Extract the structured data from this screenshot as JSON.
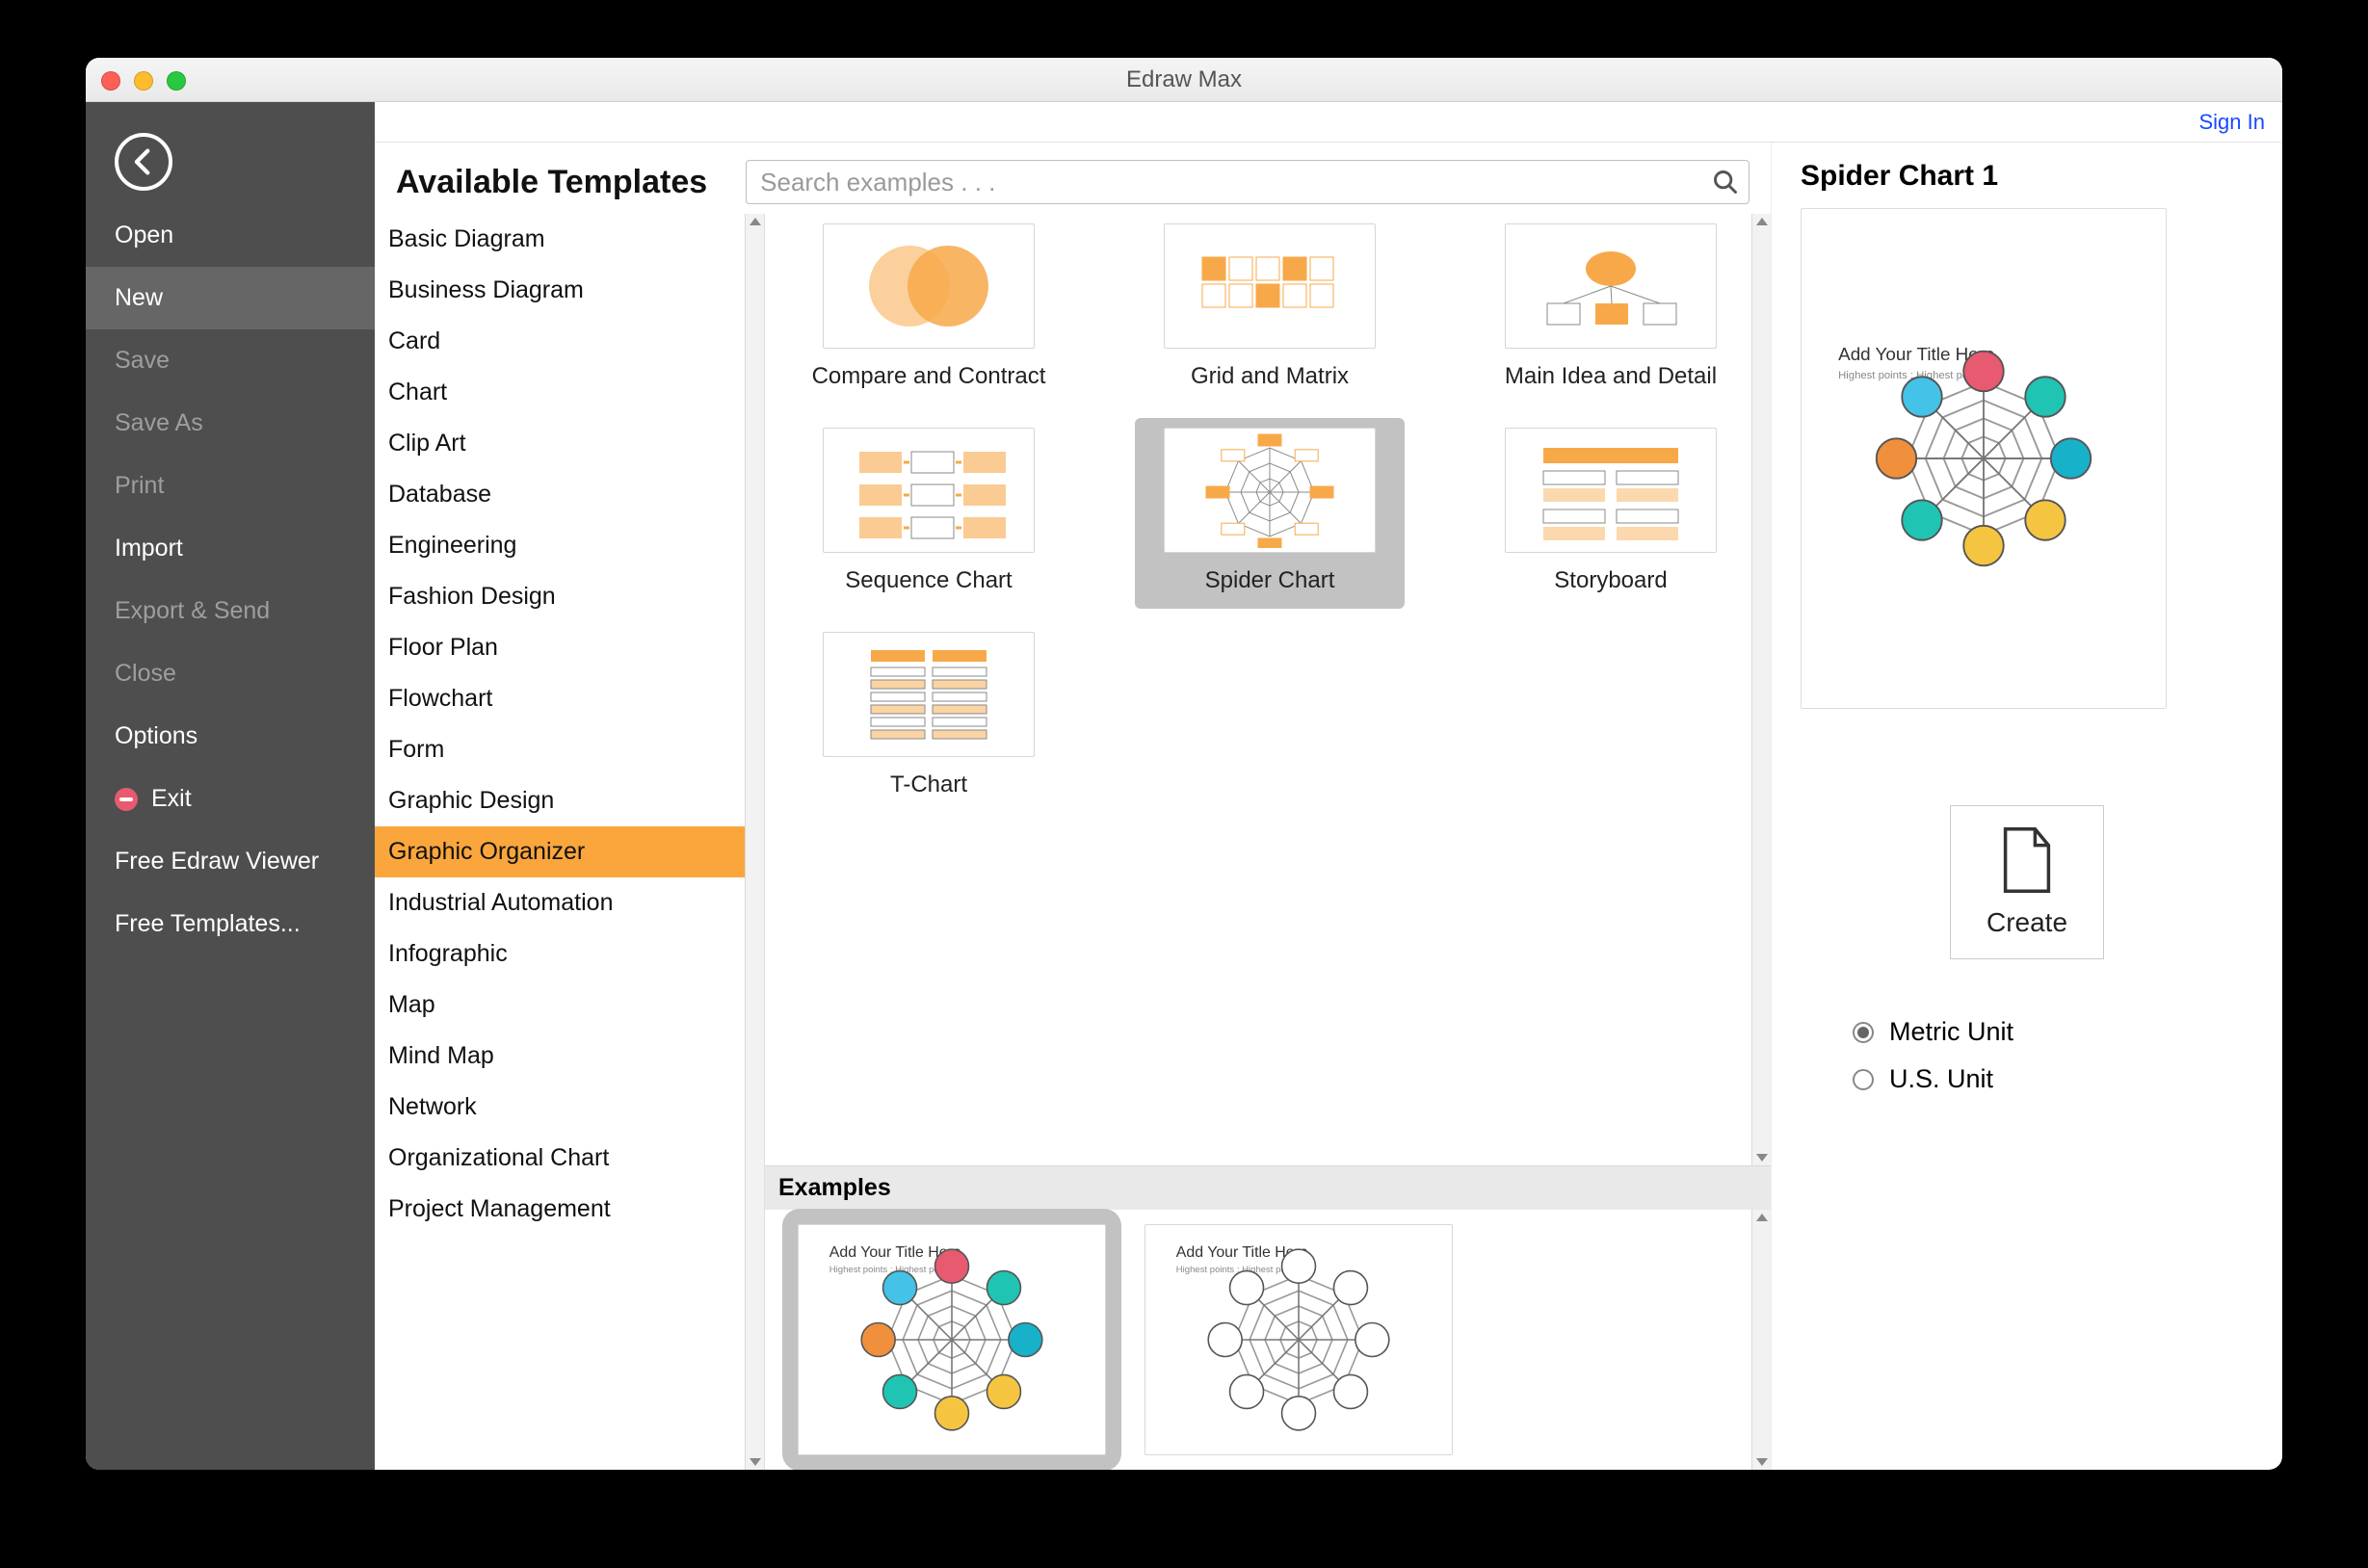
{
  "window_title": "Edraw Max",
  "signin": "Sign In",
  "page_title": "Available Templates",
  "search_placeholder": "Search examples . . .",
  "nav": [
    {
      "label": "Open",
      "state": "strong"
    },
    {
      "label": "New",
      "state": "active"
    },
    {
      "label": "Save",
      "state": "dim"
    },
    {
      "label": "Save As",
      "state": "dim"
    },
    {
      "label": "Print",
      "state": "dim"
    },
    {
      "label": "Import",
      "state": "strong"
    },
    {
      "label": "Export & Send",
      "state": "dim"
    },
    {
      "label": "Close",
      "state": "dim"
    },
    {
      "label": "Options",
      "state": "strong"
    },
    {
      "label": "Exit",
      "state": "strong",
      "icon": "exit"
    },
    {
      "label": "Free Edraw Viewer",
      "state": "strong"
    },
    {
      "label": "Free Templates...",
      "state": "strong"
    }
  ],
  "categories": [
    "Basic Diagram",
    "Business Diagram",
    "Card",
    "Chart",
    "Clip Art",
    "Database",
    "Engineering",
    "Fashion Design",
    "Floor Plan",
    "Flowchart",
    "Form",
    "Graphic Design",
    "Graphic Organizer",
    "Industrial Automation",
    "Infographic",
    "Map",
    "Mind Map",
    "Network",
    "Organizational Chart",
    "Project Management"
  ],
  "selected_category": "Graphic Organizer",
  "templates": [
    {
      "name": "Compare and Contract",
      "thumb": "venn"
    },
    {
      "name": "Grid and Matrix",
      "thumb": "grid"
    },
    {
      "name": "Main Idea and Detail",
      "thumb": "mainidea"
    },
    {
      "name": "Sequence Chart",
      "thumb": "sequence"
    },
    {
      "name": "Spider Chart",
      "thumb": "spider",
      "selected": true
    },
    {
      "name": "Storyboard",
      "thumb": "storyboard"
    },
    {
      "name": "T-Chart",
      "thumb": "tchart"
    }
  ],
  "examples_label": "Examples",
  "examples": [
    {
      "thumb": "spider-color",
      "selected": true
    },
    {
      "thumb": "spider-bw"
    }
  ],
  "info_title": "Spider Chart 1",
  "create_label": "Create",
  "units": {
    "metric": "Metric Unit",
    "us": "U.S. Unit",
    "selected": "metric"
  }
}
